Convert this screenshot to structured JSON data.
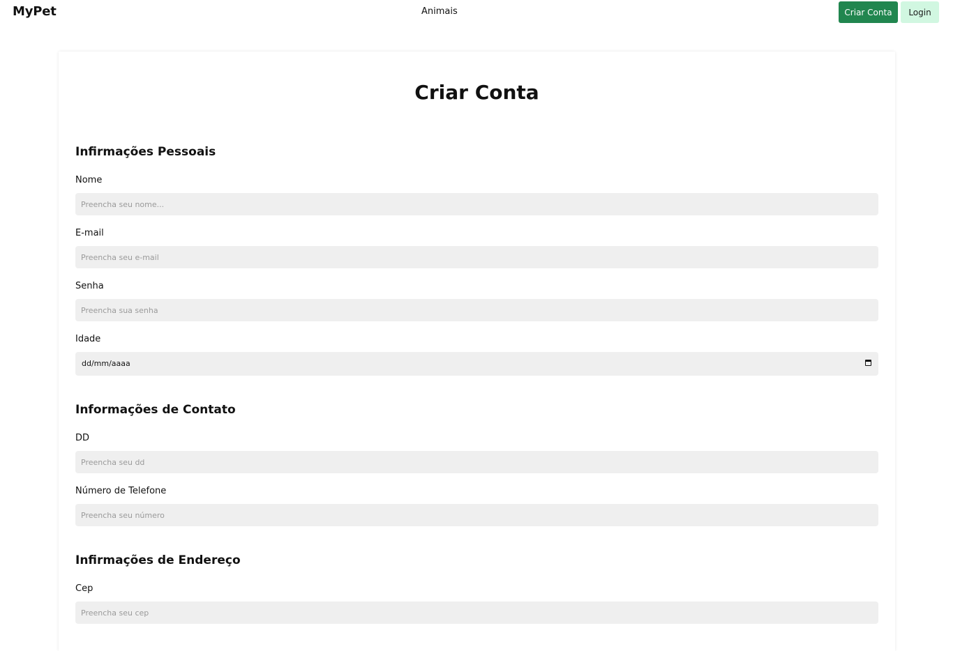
{
  "navbar": {
    "brand": "MyPet",
    "links": [
      "Animais"
    ],
    "signup_label": "Criar Conta",
    "login_label": "Login"
  },
  "form": {
    "title": "Criar Conta",
    "sections": {
      "personal": {
        "title": "Infirmações Pessoais",
        "name_label": "Nome",
        "name_placeholder": "Preencha seu nome...",
        "email_label": "E-mail",
        "email_placeholder": "Preencha seu e-mail",
        "password_label": "Senha",
        "password_placeholder": "Preencha sua senha",
        "age_label": "Idade",
        "age_value": "dd/mm/aaaa"
      },
      "contact": {
        "title": "Informações de Contato",
        "ddd_label": "DD",
        "ddd_placeholder": "Preencha seu dd",
        "phone_label": "Número de Telefone",
        "phone_placeholder": "Preencha seu número"
      },
      "address": {
        "title": "Infirmações de Endereço",
        "cep_label": "Cep",
        "cep_placeholder": "Preencha seu cep"
      }
    }
  },
  "icons": {
    "calendar": "calendar-icon"
  },
  "colors": {
    "primary_button": "#21864f",
    "secondary_button": "#d1f7e1",
    "input_background": "#efefef"
  }
}
